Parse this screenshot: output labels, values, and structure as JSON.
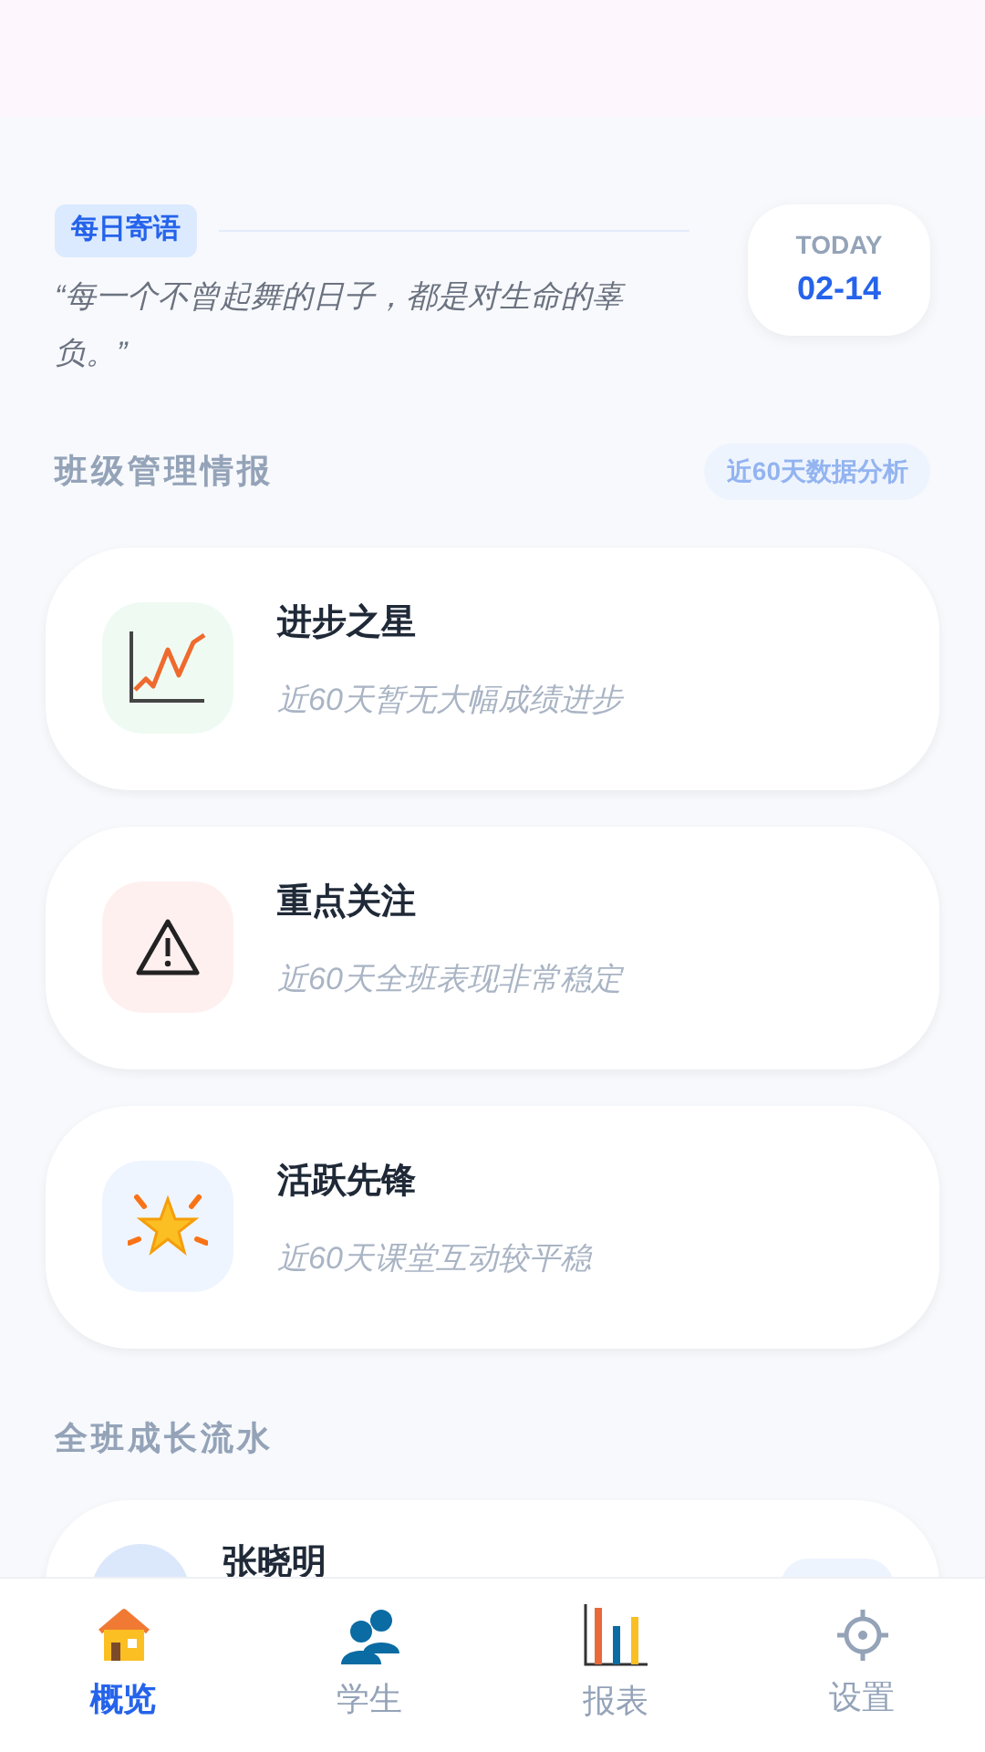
{
  "daily": {
    "tag": "每日寄语",
    "quote": "“每一个不曾起舞的日子，都是对生命的辜负。”",
    "today_label": "TODAY",
    "date": "02-14"
  },
  "intel": {
    "title": "班级管理情报",
    "badge": "近60天数据分析",
    "cards": [
      {
        "kind": "progress",
        "title": "进步之星",
        "subtitle": "近60天暂无大幅成绩进步"
      },
      {
        "kind": "warning",
        "title": "重点关注",
        "subtitle": "近60天全班表现非常稳定"
      },
      {
        "kind": "active",
        "title": "活跃先锋",
        "subtitle": "近60天课堂互动较平稳"
      }
    ]
  },
  "feed": {
    "title": "全班成长流水",
    "items": [
      {
        "name": "张晓明"
      }
    ]
  },
  "tabs": [
    {
      "kind": "home",
      "label": "概览",
      "selected": true
    },
    {
      "kind": "students",
      "label": "学生",
      "selected": false
    },
    {
      "kind": "reports",
      "label": "报表",
      "selected": false
    },
    {
      "kind": "settings",
      "label": "设置",
      "selected": false
    }
  ]
}
